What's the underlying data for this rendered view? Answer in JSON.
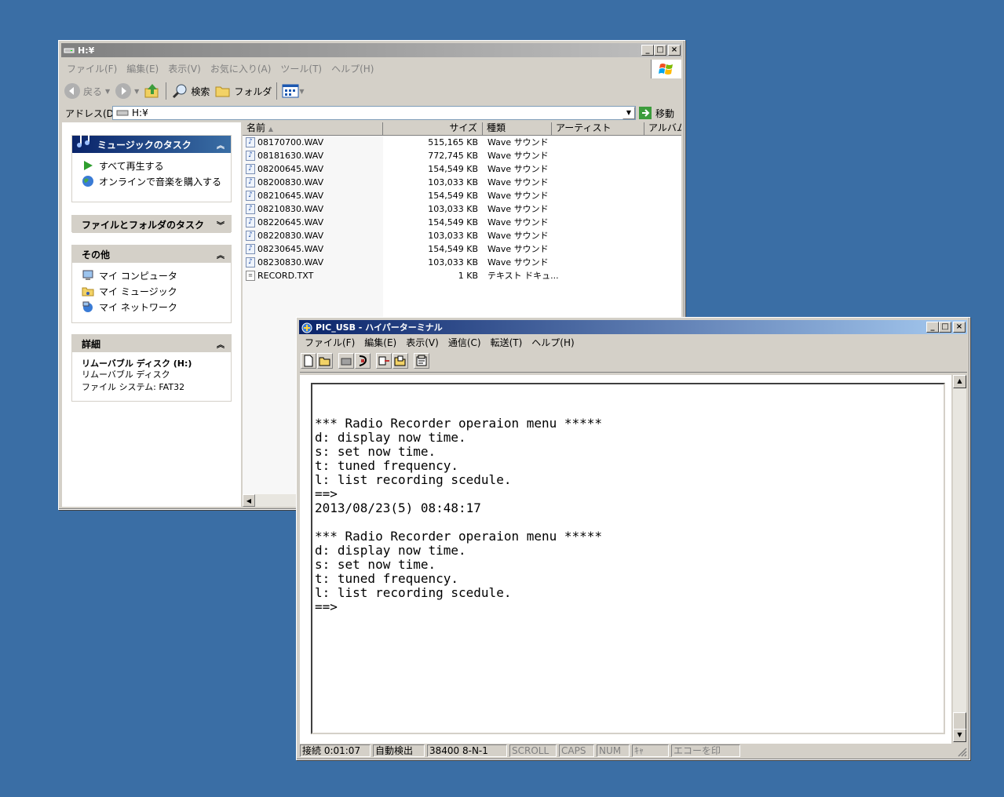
{
  "explorer": {
    "title": "H:¥",
    "menu": [
      "ファイル(F)",
      "編集(E)",
      "表示(V)",
      "お気に入り(A)",
      "ツール(T)",
      "ヘルプ(H)"
    ],
    "toolbar": {
      "back": "戻る",
      "search": "検索",
      "folder": "フォルダ"
    },
    "address_label": "アドレス(D)",
    "address_value": "H:¥",
    "go_label": "移動",
    "tasks": {
      "music_title": "ミュージックのタスク",
      "music_items": [
        "すべて再生する",
        "オンラインで音楽を購入する"
      ],
      "file_title": "ファイルとフォルダのタスク",
      "other_title": "その他",
      "other_items": [
        "マイ コンピュータ",
        "マイ ミュージック",
        "マイ ネットワーク"
      ],
      "detail_title": "詳細",
      "detail_name": "リムーバブル ディスク (H:)",
      "detail_type": "リムーバブル ディスク",
      "detail_fs": "ファイル システム: FAT32"
    },
    "columns": [
      "名前",
      "サイズ",
      "種類",
      "アーティスト",
      "アルバム"
    ],
    "files": [
      {
        "name": "08170700.WAV",
        "size": "515,165 KB",
        "type": "Wave サウンド"
      },
      {
        "name": "08181630.WAV",
        "size": "772,745 KB",
        "type": "Wave サウンド"
      },
      {
        "name": "08200645.WAV",
        "size": "154,549 KB",
        "type": "Wave サウンド"
      },
      {
        "name": "08200830.WAV",
        "size": "103,033 KB",
        "type": "Wave サウンド"
      },
      {
        "name": "08210645.WAV",
        "size": "154,549 KB",
        "type": "Wave サウンド"
      },
      {
        "name": "08210830.WAV",
        "size": "103,033 KB",
        "type": "Wave サウンド"
      },
      {
        "name": "08220645.WAV",
        "size": "154,549 KB",
        "type": "Wave サウンド"
      },
      {
        "name": "08220830.WAV",
        "size": "103,033 KB",
        "type": "Wave サウンド"
      },
      {
        "name": "08230645.WAV",
        "size": "154,549 KB",
        "type": "Wave サウンド"
      },
      {
        "name": "08230830.WAV",
        "size": "103,033 KB",
        "type": "Wave サウンド"
      },
      {
        "name": "RECORD.TXT",
        "size": "1 KB",
        "type": "テキスト ドキュ..."
      }
    ]
  },
  "hyper": {
    "title": "PIC_USB - ハイパーターミナル",
    "menu": [
      "ファイル(F)",
      "編集(E)",
      "表示(V)",
      "通信(C)",
      "転送(T)",
      "ヘルプ(H)"
    ],
    "terminal_lines": [
      "*** Radio Recorder operaion menu *****",
      "d: display now time.",
      "s: set now time.",
      "t: tuned frequency.",
      "l: list recording scedule.",
      "==>",
      "2013/08/23(5) 08:48:17",
      "",
      "*** Radio Recorder operaion menu *****",
      "d: display now time.",
      "s: set now time.",
      "t: tuned frequency.",
      "l: list recording scedule.",
      "==>"
    ],
    "status": {
      "connected": "接続 0:01:07",
      "detect": "自動検出",
      "settings": "38400 8-N-1",
      "scroll": "SCROLL",
      "caps": "CAPS",
      "num": "NUM",
      "capture": "ｷｬ",
      "print": "エコーを印"
    }
  },
  "colors": {
    "desktop": "#3a6ea5",
    "active_title": "#0a246a",
    "inactive_title": "#808080"
  }
}
